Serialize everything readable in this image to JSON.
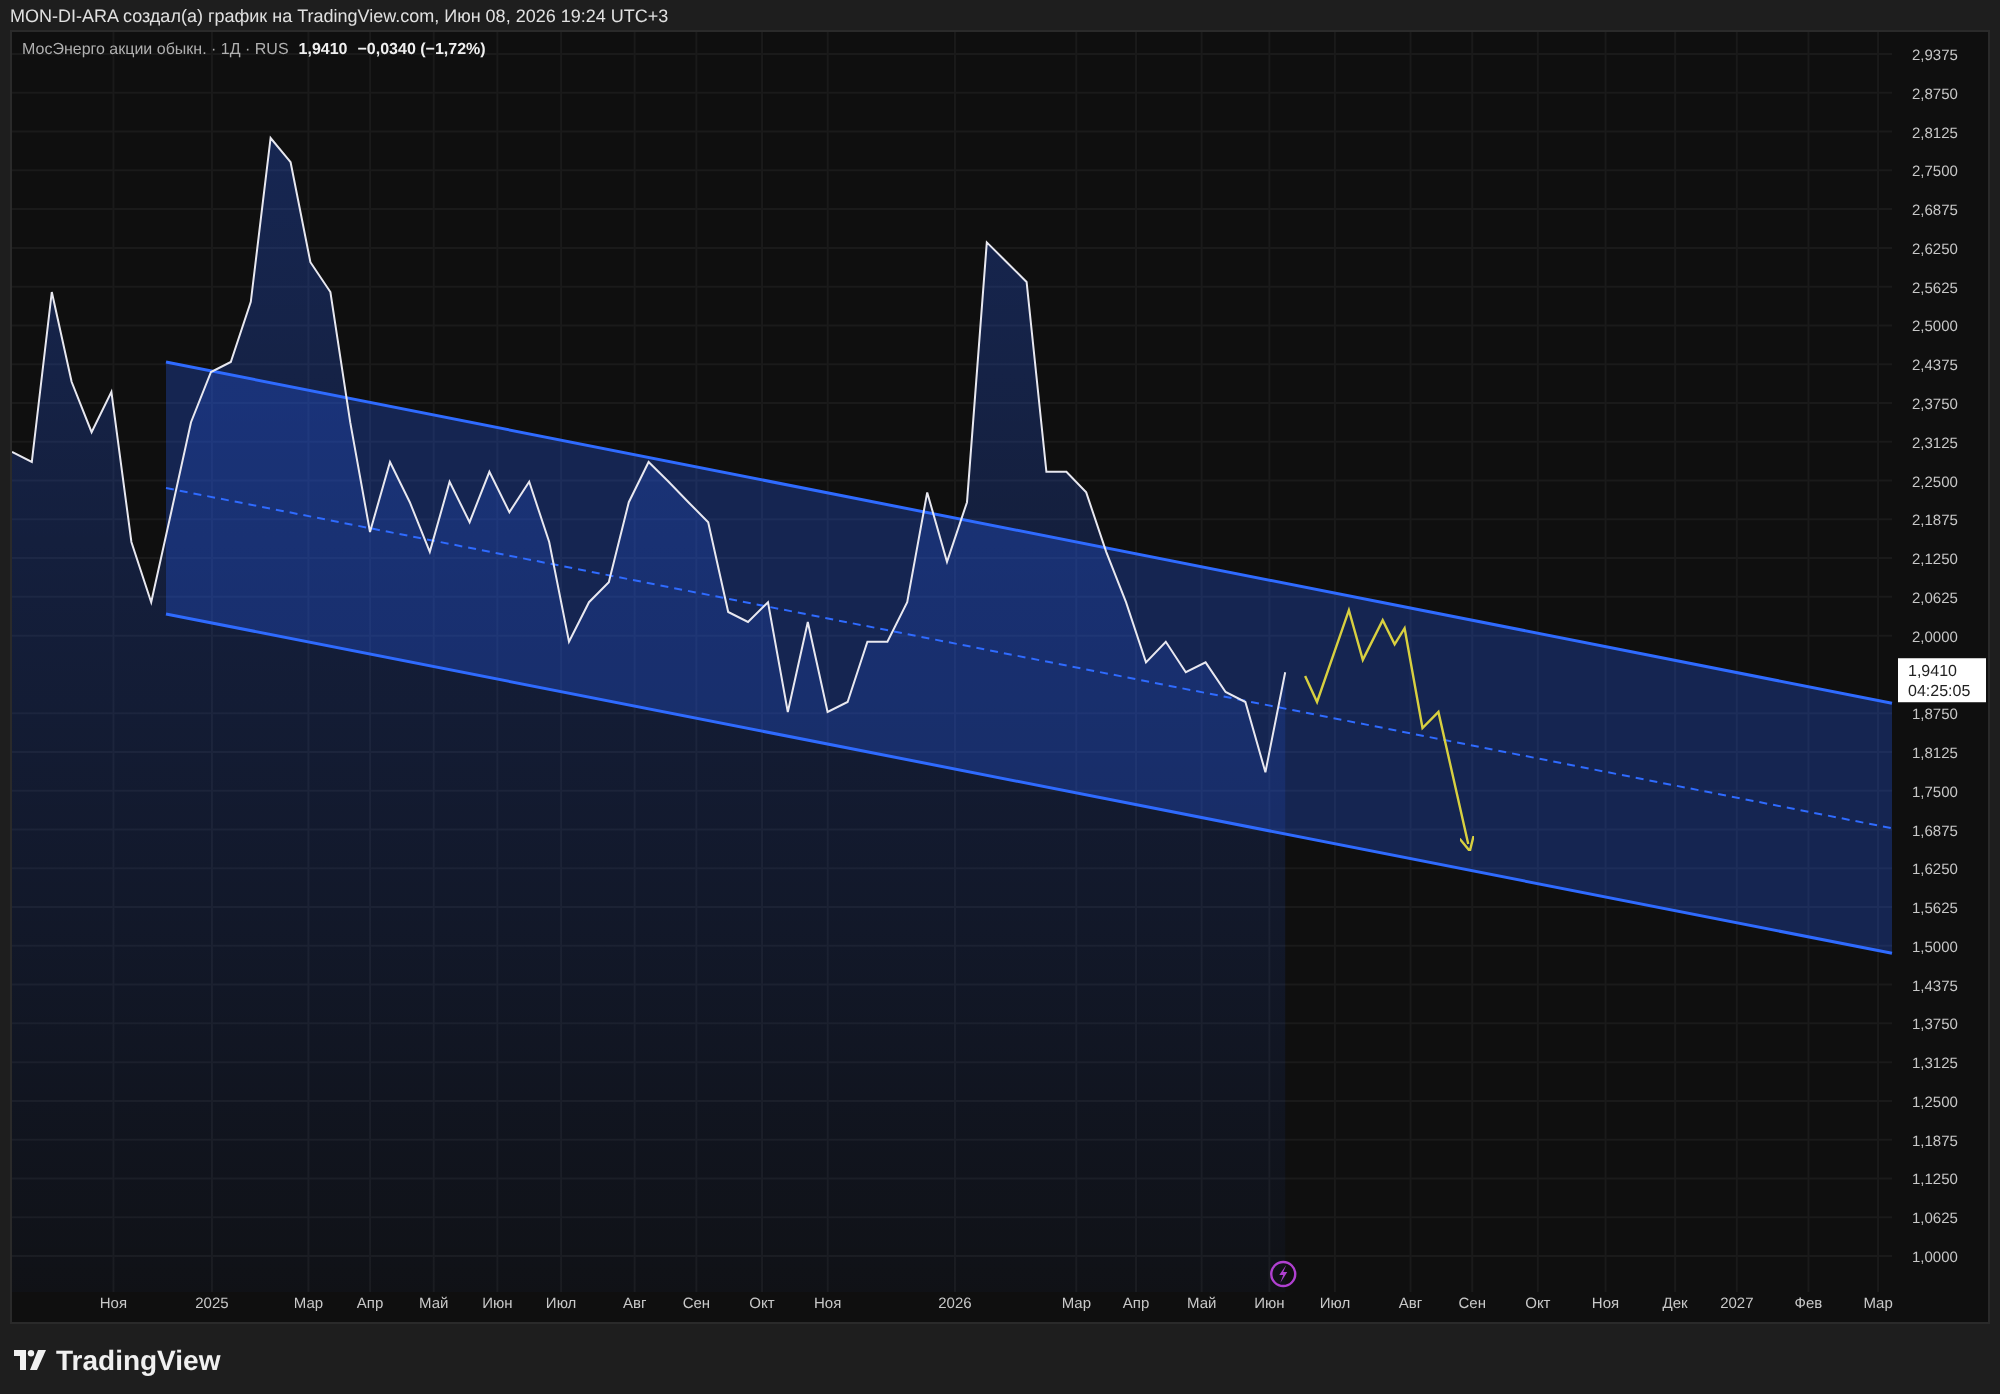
{
  "header": {
    "title": "MON-DI-ARA создал(а) график на TradingView.com, Июн 08, 2026 19:24 UTC+3"
  },
  "legend": {
    "symbol": "МосЭнерго акции обыкн. · 1Д · RUS",
    "price": "1,9410",
    "change": "−0,0340 (−1,72%)"
  },
  "chart": {
    "last_price": {
      "value": "1,9410",
      "countdown": "04:25:05"
    },
    "price_axis": [
      "2,9375",
      "2,8750",
      "2,8125",
      "2,7500",
      "2,6875",
      "2,6250",
      "2,5625",
      "2,5000",
      "2,4375",
      "2,3750",
      "2,3125",
      "2,2500",
      "2,1875",
      "2,1250",
      "2,0625",
      "2,0000",
      "1,8750",
      "1,8125",
      "1,7500",
      "1,6875",
      "1,6250",
      "1,5625",
      "1,5000",
      "1,4375",
      "1,3750",
      "1,3125",
      "1,2500",
      "1,1875",
      "1,1250",
      "1,0625",
      "1,0000"
    ],
    "time_axis": [
      "Ноя",
      "2025",
      "Мар",
      "Апр",
      "Май",
      "Июн",
      "Июл",
      "Авг",
      "Сен",
      "Окт",
      "Ноя",
      "2026",
      "Мар",
      "Апр",
      "Май",
      "Июн",
      "Июл",
      "Авг",
      "Сен",
      "Окт",
      "Ноя",
      "Дек",
      "2027",
      "Фев",
      "Мар"
    ]
  },
  "footer": {
    "brand": "TradingView"
  }
}
